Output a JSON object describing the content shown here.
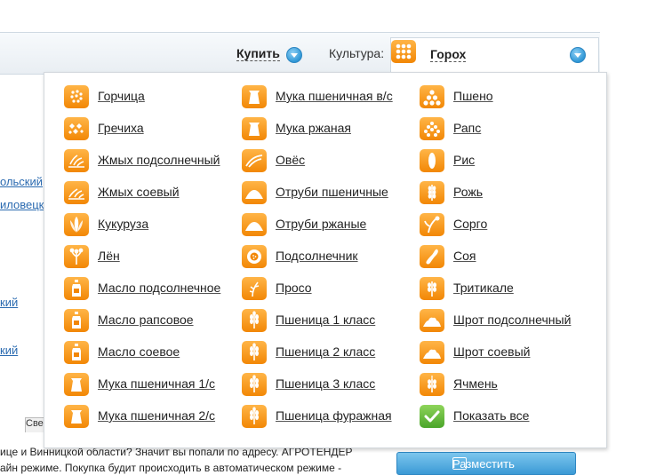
{
  "toolbar": {
    "buy_label": "Купить",
    "culture_label": "Культура:",
    "selected_culture": "Горох"
  },
  "columns": [
    [
      {
        "label": "Горчица",
        "icon": "mustard-seeds-icon"
      },
      {
        "label": "Гречиха",
        "icon": "buckwheat-icon"
      },
      {
        "label": "Жмых подсолнечный",
        "icon": "sunflower-cake-icon"
      },
      {
        "label": "Жмых соевый",
        "icon": "soy-cake-icon"
      },
      {
        "label": "Кукуруза",
        "icon": "corn-icon"
      },
      {
        "label": "Лён",
        "icon": "flax-icon"
      },
      {
        "label": "Масло подсолнечное",
        "icon": "oil-bottle-icon"
      },
      {
        "label": "Масло рапсовое",
        "icon": "oil-bottle-icon"
      },
      {
        "label": "Масло соевое",
        "icon": "oil-bottle-icon"
      },
      {
        "label": "Мука пшеничная 1/с",
        "icon": "flour-sack-icon"
      },
      {
        "label": "Мука пшеничная 2/с",
        "icon": "flour-sack-icon"
      }
    ],
    [
      {
        "label": "Мука пшеничная в/с",
        "icon": "flour-sack-icon"
      },
      {
        "label": "Мука ржаная",
        "icon": "flour-sack-icon"
      },
      {
        "label": "Овёс",
        "icon": "oats-icon"
      },
      {
        "label": "Отруби пшеничные",
        "icon": "bran-pile-icon"
      },
      {
        "label": "Отруби ржаные",
        "icon": "bran-pile-icon"
      },
      {
        "label": "Подсолнечник",
        "icon": "sunflower-icon"
      },
      {
        "label": "Просо",
        "icon": "millet-icon"
      },
      {
        "label": "Пшеница 1 класс",
        "icon": "wheat-ear-icon"
      },
      {
        "label": "Пшеница 2 класс",
        "icon": "wheat-ear-icon"
      },
      {
        "label": "Пшеница 3 класс",
        "icon": "wheat-ear-icon"
      },
      {
        "label": "Пшеница фуражная",
        "icon": "wheat-ear-icon"
      }
    ],
    [
      {
        "label": "Пшено",
        "icon": "millet-grains-icon"
      },
      {
        "label": "Рапс",
        "icon": "rapeseed-icon"
      },
      {
        "label": "Рис",
        "icon": "rice-grain-icon"
      },
      {
        "label": "Рожь",
        "icon": "rye-ear-icon"
      },
      {
        "label": "Сорго",
        "icon": "sorghum-icon"
      },
      {
        "label": "Соя",
        "icon": "soybean-icon"
      },
      {
        "label": "Тритикале",
        "icon": "triticale-icon"
      },
      {
        "label": "Шрот подсолнечный",
        "icon": "meal-pile-icon"
      },
      {
        "label": "Шрот соевый",
        "icon": "meal-pile-icon"
      },
      {
        "label": "Ячмень",
        "icon": "barley-icon"
      },
      {
        "label": "Показать все",
        "icon": "checkmark-icon",
        "color": "#5fb83a"
      }
    ]
  ],
  "left_links": [
    "ольский",
    "иловецк",
    "кий",
    "кий"
  ],
  "bottom": {
    "line1": "ице и  Винницкой области? Значит вы  попали по адресу. AГРОТЕНДЕР",
    "line2": "айн режиме. Покупка будит происходить в автоматическом режиме -",
    "tab_label": "Све",
    "post_button": "Разместить"
  },
  "colors": {
    "accent_orange": "#f28705",
    "accent_blue": "#2f97d6",
    "green": "#5fb83a"
  }
}
